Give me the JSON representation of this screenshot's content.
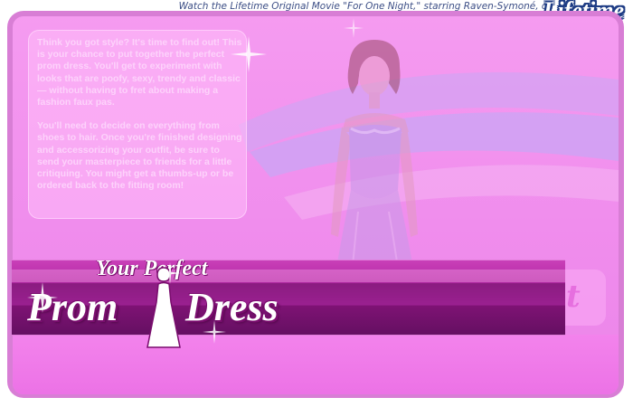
{
  "promo": {
    "text": "Watch the Lifetime Original Movie \"For One Night,\" starring Raven-Symoné, on",
    "logo": "Lifetime"
  },
  "intro": {
    "paragraph1": "Think you got style? It's time to find out! This is your chance to put together the perfect prom dress. You'll get to experiment with looks that are poofy, sexy, trendy and classic — without having to fret about making a fashion faux pas.",
    "paragraph2": "You'll need to decide on everything from shoes to hair. Once you're finished designing and accessorizing your outfit, be sure to send your masterpiece to friends for a little critiquing. You might get a thumbs-up or be ordered back to the fitting room!"
  },
  "title": {
    "line1": "Your Perfect",
    "word_prom": "Prom",
    "word_dress": "Dress"
  },
  "ghost_button_text": "t",
  "colors": {
    "stage": "#f08ded",
    "banner": "#9a2090",
    "frame": "#d87ed5",
    "logo_outline": "#1f3d85"
  },
  "icons": [
    "sparkle-icon",
    "woman-silhouette-icon",
    "model-figure"
  ]
}
